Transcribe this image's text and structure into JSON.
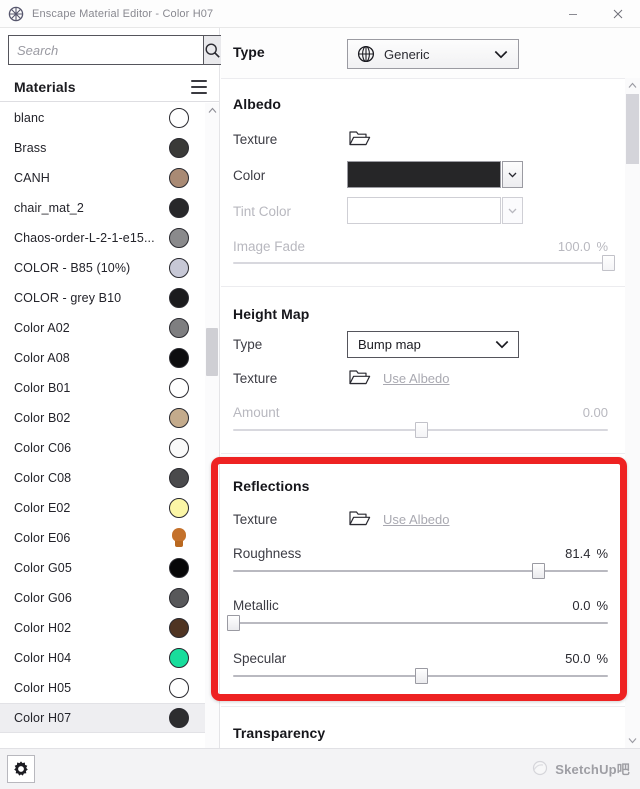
{
  "window": {
    "title": "Enscape Material Editor - Color H07",
    "app_icon": "enscape-icon",
    "minimize_label": "–",
    "close_label": "✕"
  },
  "sidebar": {
    "search": {
      "placeholder": "Search",
      "value": "",
      "icon": "search-icon"
    },
    "header": {
      "title": "Materials",
      "menu_icon": "hamburger-menu-icon"
    },
    "selected_material": "Color H07",
    "materials": [
      {
        "name": "blanc",
        "color": "#ffffff",
        "shape": "circle"
      },
      {
        "name": "Brass",
        "color": "#3a3a38",
        "shape": "circle"
      },
      {
        "name": "CANH",
        "color": "#a98a74",
        "shape": "circle"
      },
      {
        "name": "chair_mat_2",
        "color": "#28282a",
        "shape": "circle"
      },
      {
        "name": "Chaos-order-L-2-1-e15...",
        "color": "#8a8a8c",
        "shape": "circle"
      },
      {
        "name": "COLOR - B85 (10%)",
        "color": "#c7c8d6",
        "shape": "circle"
      },
      {
        "name": "COLOR - grey B10",
        "color": "#1b1b1d",
        "shape": "circle"
      },
      {
        "name": "Color A02",
        "color": "#7e7e80",
        "shape": "circle"
      },
      {
        "name": "Color A08",
        "color": "#0d0d0f",
        "shape": "circle"
      },
      {
        "name": "Color B01",
        "color": "#ffffff",
        "shape": "circle"
      },
      {
        "name": "Color B02",
        "color": "#c4ab8c",
        "shape": "circle"
      },
      {
        "name": "Color C06",
        "color": "#fafafa",
        "shape": "circle"
      },
      {
        "name": "Color C08",
        "color": "#4a4a4c",
        "shape": "circle"
      },
      {
        "name": "Color E02",
        "color": "#fbf6a6",
        "shape": "circle"
      },
      {
        "name": "Color E06",
        "color": "#c4712b",
        "shape": "bulb"
      },
      {
        "name": "Color G05",
        "color": "#070708",
        "shape": "circle"
      },
      {
        "name": "Color G06",
        "color": "#58585a",
        "shape": "circle"
      },
      {
        "name": "Color H02",
        "color": "#4f3422",
        "shape": "circle"
      },
      {
        "name": "Color H04",
        "color": "#18dd9c",
        "shape": "circle"
      },
      {
        "name": "Color H05",
        "color": "#ffffff",
        "shape": "circle"
      },
      {
        "name": "Color H07",
        "color": "#2d2d2f",
        "shape": "circle"
      }
    ],
    "scrollbar": {
      "up_icon": "chevron-up-icon",
      "down_icon": "chevron-down-icon"
    }
  },
  "type_bar": {
    "label": "Type",
    "value": "Generic",
    "icon": "material-sphere-icon",
    "chevron": "chevron-down-icon"
  },
  "albedo": {
    "title": "Albedo",
    "texture": {
      "label": "Texture",
      "icon": "folder-icon"
    },
    "color": {
      "label": "Color",
      "value_hex": "#262628",
      "chevron": "chevron-down-icon"
    },
    "tint_color": {
      "label": "Tint Color",
      "value_hex": "#ffffff",
      "chevron": "chevron-down-icon",
      "disabled": true
    },
    "image_fade": {
      "label": "Image Fade",
      "value": "100.0",
      "unit": "%",
      "percent": 100,
      "disabled": true
    }
  },
  "height_map": {
    "title": "Height Map",
    "type": {
      "label": "Type",
      "value": "Bump map",
      "chevron": "chevron-down-icon"
    },
    "texture": {
      "label": "Texture",
      "icon": "folder-icon",
      "link": "Use Albedo"
    },
    "amount": {
      "label": "Amount",
      "value": "0.00",
      "unit": "",
      "percent": 50,
      "disabled": true
    }
  },
  "reflections": {
    "title": "Reflections",
    "texture": {
      "label": "Texture",
      "icon": "folder-icon",
      "link": "Use Albedo"
    },
    "roughness": {
      "label": "Roughness",
      "value": "81.4",
      "unit": "%",
      "percent": 81.4
    },
    "metallic": {
      "label": "Metallic",
      "value": "0.0",
      "unit": "%",
      "percent": 0
    },
    "specular": {
      "label": "Specular",
      "value": "50.0",
      "unit": "%",
      "percent": 50
    }
  },
  "transparency": {
    "title": "Transparency"
  },
  "bottom_bar": {
    "settings_icon": "gear-icon",
    "watermark_text": "SketchUp吧",
    "watermark_icon": "sketchup-logo-icon"
  },
  "colors": {
    "highlight_box": "#ee2222",
    "selection_bg": "#eeeef1",
    "text": "#23232a"
  }
}
